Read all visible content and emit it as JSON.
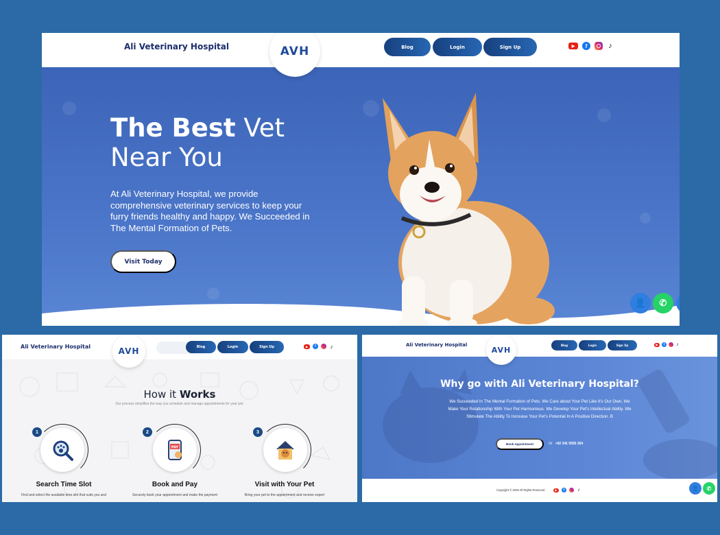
{
  "brand": "Ali Veterinary Hospital",
  "logo": "AVH",
  "nav": {
    "blog": "Blog",
    "login": "Login",
    "signup": "Sign Up"
  },
  "social": [
    "youtube-icon",
    "facebook-icon",
    "instagram-icon",
    "tiktok-icon"
  ],
  "hero": {
    "title_bold": "The Best",
    "title_light_1": "Vet",
    "title_light_2": "Near You",
    "description": "At Ali Veterinary Hospital, we provide comprehensive veterinary services to keep your furry friends healthy and happy. We Succeeded in The Mental Formation of Pets.",
    "cta": "Visit Today"
  },
  "works": {
    "title_light": "How it",
    "title_bold": "Works",
    "subtitle": "Our process simplifies the way you schedule and manage appointments for your pet.",
    "steps": [
      {
        "num": "1",
        "title": "Search Time Slot",
        "desc": "Find and select the available time slot that suits you and"
      },
      {
        "num": "2",
        "title": "Book and Pay",
        "desc": "Securely book your appointment and make the payment"
      },
      {
        "num": "3",
        "title": "Visit with Your Pet",
        "desc": "Bring your pet to the appointment and receive expert"
      }
    ]
  },
  "why": {
    "title": "Why go with Ali Veterinary Hospital?",
    "description": "We Succeeded In The Mental Formation of Pets. We Care about Your Pet Like It's Our Own. We Make Your Relationship With Your Pet Harmonious. We Develop Your Pet's Intellectual Ability. We Stimulate The Ability To Increase Your Pet's Potential In A Positive Direction. B",
    "cta": "Book Appointment",
    "or": "Or",
    "phone": "+92 341 5555 264",
    "copyright": "Copyright © 2025 All Rights Reserved"
  },
  "colors": {
    "page_bg": "#2b6aa6",
    "hero_blue": "#4b76c9",
    "nav_btn": "#17407e",
    "brand_text": "#1b2d6b",
    "whatsapp": "#25d366"
  }
}
